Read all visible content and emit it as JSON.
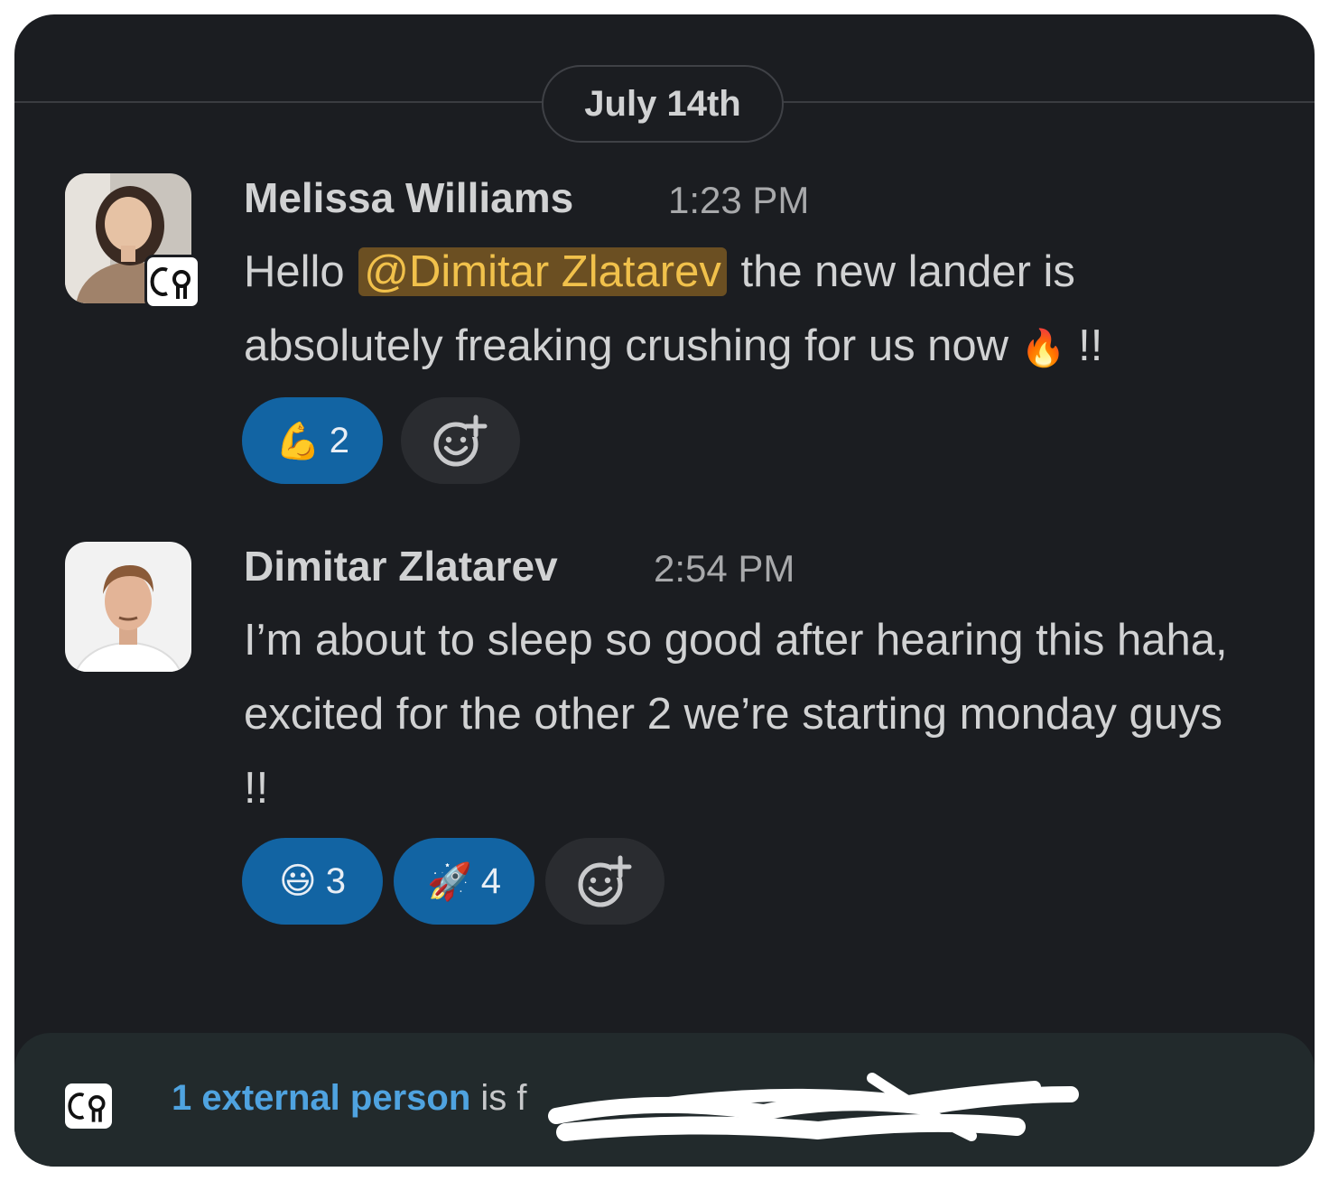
{
  "date_divider": "July 14th",
  "messages": [
    {
      "author": "Melissa Williams",
      "time": "1:23 PM",
      "text_before": "Hello",
      "mention": "@Dimitar Zlatarev",
      "text_after": "the new lander is absolutely freaking crushing for us now",
      "emoji_inline": "🔥",
      "text_end": "!!",
      "reactions": [
        {
          "emoji": "💪",
          "count": "2"
        }
      ]
    },
    {
      "author": "Dimitar Zlatarev",
      "time": "2:54 PM",
      "text": "I’m about to sleep so good after hearing this haha, excited for the other 2 we’re starting monday guys !!",
      "reactions": [
        {
          "emoji": "😃",
          "count": "3"
        },
        {
          "emoji": "🚀",
          "count": "4"
        }
      ]
    }
  ],
  "footer": {
    "link_text": "1 external person",
    "text": "is f"
  },
  "badge_text": "CO",
  "colors": {
    "background": "#1b1d21",
    "reaction_active": "#1264a3",
    "mention_bg": "#6b4f22",
    "mention_text": "#f1c14b",
    "footer_link": "#4fa3e0"
  }
}
